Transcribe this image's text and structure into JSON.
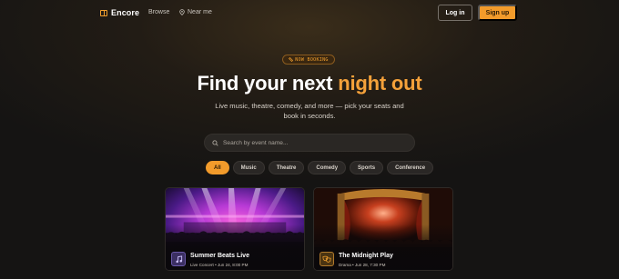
{
  "nav": {
    "brand": "Encore",
    "links": {
      "browse": "Browse",
      "near_me": "Near me"
    },
    "login_label": "Log in",
    "signup_label": "Sign up"
  },
  "hero": {
    "badge": "NOW BOOKING",
    "headline_prefix": "Find your next ",
    "headline_accent": "night out",
    "subtitle": "Live music, theatre, comedy, and more — pick your seats and book in seconds."
  },
  "search": {
    "placeholder": "Search by event name...",
    "value": ""
  },
  "categories": [
    "All",
    "Music",
    "Theatre",
    "Comedy",
    "Sports",
    "Conference"
  ],
  "active_category": "All",
  "events": [
    {
      "title": "Summer Beats Live",
      "meta": "Live Concert • Jun 24, 8:00 PM",
      "icon": "music-note-icon"
    },
    {
      "title": "The Midnight Play",
      "meta": "Drama • Jun 28, 7:30 PM",
      "icon": "theater-masks-icon"
    }
  ],
  "colors": {
    "accent": "#f29b2b",
    "background": "#151413"
  }
}
